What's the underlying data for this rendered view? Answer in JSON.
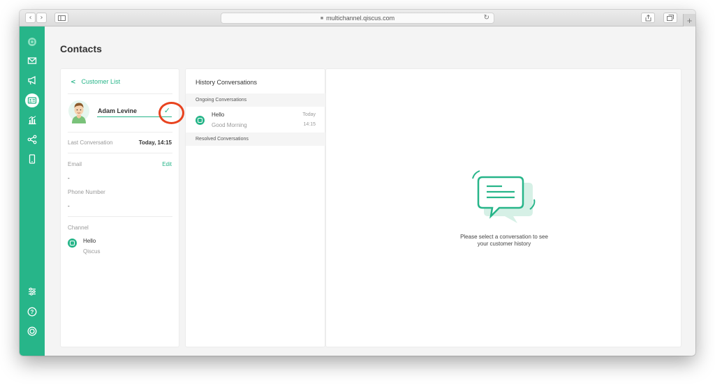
{
  "browser": {
    "url": "multichannel.qiscus.com",
    "back_icon": "chevron-left-icon",
    "forward_icon": "chevron-right-icon",
    "sidebar_icon": "sidebar-icon",
    "reload_icon": "reload-icon",
    "share_icon": "share-icon",
    "tabs_icon": "tabs-icon",
    "new_tab_icon": "plus-icon"
  },
  "nav": {
    "items": [
      {
        "name": "logo-icon"
      },
      {
        "name": "mail-icon"
      },
      {
        "name": "megaphone-icon"
      },
      {
        "name": "contacts-icon",
        "active": true
      },
      {
        "name": "analytics-icon"
      },
      {
        "name": "integration-icon"
      },
      {
        "name": "mobile-icon"
      },
      {
        "name": "settings-sliders-icon"
      },
      {
        "name": "help-icon"
      },
      {
        "name": "profile-icon"
      }
    ]
  },
  "page": {
    "title": "Contacts"
  },
  "contact": {
    "back_label": "Customer List",
    "name": "Adam Levine",
    "last_conversation_label": "Last Conversation",
    "last_conversation_value": "Today, 14:15",
    "email_label": "Email",
    "email_value": "-",
    "edit_label": "Edit",
    "phone_label": "Phone Number",
    "phone_value": "-",
    "channel_label": "Channel",
    "channel_name": "Hello",
    "channel_provider": "Qiscus"
  },
  "history": {
    "title": "History Conversations",
    "ongoing_label": "Ongoing Conversations",
    "resolved_label": "Resolved Conversations",
    "conversations": [
      {
        "name": "Hello",
        "message": "Good Morning",
        "day": "Today",
        "time": "14:15"
      }
    ]
  },
  "empty_state": {
    "line1": "Please select a conversation to see",
    "line2": "your customer history"
  },
  "colors": {
    "accent": "#27b589",
    "highlight_ring": "#e8431f"
  }
}
